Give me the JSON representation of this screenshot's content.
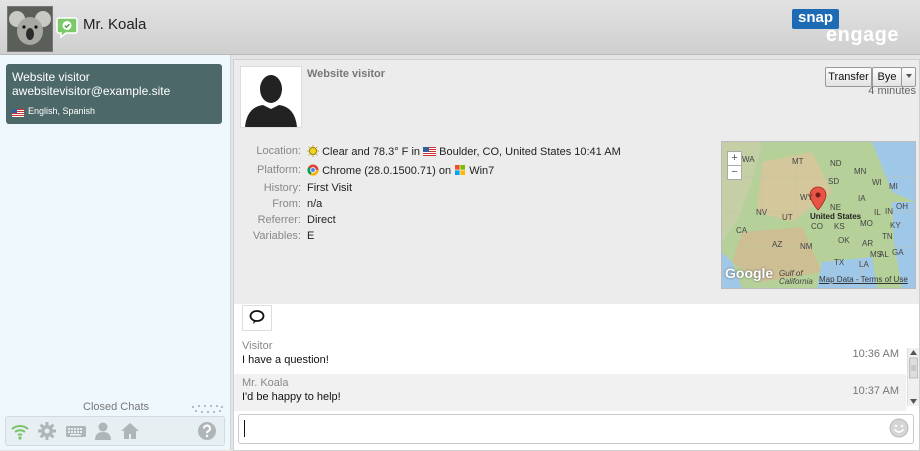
{
  "header": {
    "agent_name": "Mr. Koala",
    "logo_top": "snap",
    "logo_bottom": "engage",
    "brand_color": "#1d6bb5"
  },
  "sidebar": {
    "active_chat": {
      "title": "Website visitor",
      "email": "awebsitevisitor@example.site",
      "languages": "English, Spanish"
    },
    "closed_chats_label": "Closed Chats",
    "toolbar_icons": [
      "wifi-icon",
      "gear-icon",
      "keyboard-icon",
      "person-icon",
      "home-icon",
      "help-icon"
    ]
  },
  "visitor": {
    "title": "Website visitor",
    "duration": "4 minutes",
    "buttons": {
      "transfer": "Transfer",
      "bye": "Bye"
    },
    "labels": {
      "location": "Location:",
      "platform": "Platform:",
      "history": "History:",
      "from": "From:",
      "referrer": "Referrer:",
      "variables": "Variables:"
    },
    "location": {
      "weather": "Clear and 78.3° F in",
      "place": "Boulder, CO, United States 10:41 AM"
    },
    "platform": {
      "browser": "Chrome (28.0.1500.71) on",
      "os": "Win7"
    },
    "history": "First Visit",
    "from": "n/a",
    "referrer": "Direct",
    "variables": "E"
  },
  "map": {
    "country_label": "United States",
    "google_label": "Google",
    "map_data": "Map Data",
    "terms": "Terms of Use",
    "zoom_in": "+",
    "zoom_out": "−",
    "gulf_label": "Gulf of California",
    "state_labels": [
      "WA",
      "MT",
      "ND",
      "MN",
      "WI",
      "MI",
      "SD",
      "WY",
      "IA",
      "NE",
      "NV",
      "UT",
      "CO",
      "KS",
      "MO",
      "IL",
      "IN",
      "OH",
      "KY",
      "CA",
      "OK",
      "AR",
      "TN",
      "AZ",
      "NM",
      "MS",
      "AL",
      "GA",
      "TX",
      "LA"
    ]
  },
  "messages": [
    {
      "author": "Visitor",
      "text": "I have a question!",
      "time": "10:36 AM"
    },
    {
      "author": "Mr. Koala",
      "text": "I'd be happy to help!",
      "time": "10:37 AM"
    }
  ]
}
